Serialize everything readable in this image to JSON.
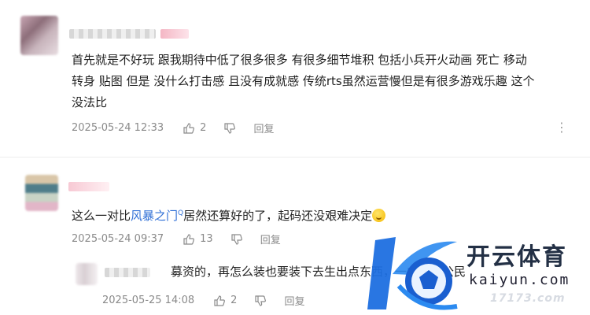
{
  "comments": [
    {
      "text_line1": "首先就是不好玩 跟我期待中低了很多很多 有很多细节堆积 包括小兵开火动画 死亡 移动",
      "text_line2": "转身 贴图 但是 没什么打击感 且没有成就感 传统rts虽然运营慢但是有很多游戏乐趣 这个",
      "text_line3": "没法比",
      "timestamp": "2025-05-24 12:33",
      "likes": "2",
      "reply_label": "回复",
      "more_label": "⋮"
    },
    {
      "text_prefix": "这么一对比",
      "link_text": "风暴之门",
      "link_sup": "Q",
      "text_suffix": "居然还算好的了，起码还没艰难决定",
      "timestamp": "2025-05-24 09:37",
      "likes": "13",
      "reply_label": "回复"
    },
    {
      "text": "募资的，再怎么装也要装下去生出点东西，一向星际公民",
      "timestamp": "2025-05-25 14:08",
      "likes": "2",
      "reply_label": "回复"
    }
  ],
  "watermark": {
    "title": "开云体育",
    "subtitle": "kaiyun.com",
    "bottom": "17173.com"
  },
  "colors": {
    "link": "#2f6fd6",
    "meta": "#8a8a8a",
    "watermark_blue": "#1e6fe0"
  },
  "icons": [
    "thumbs-up-icon",
    "thumbs-down-icon",
    "more-vertical-icon",
    "emoji-icon"
  ]
}
